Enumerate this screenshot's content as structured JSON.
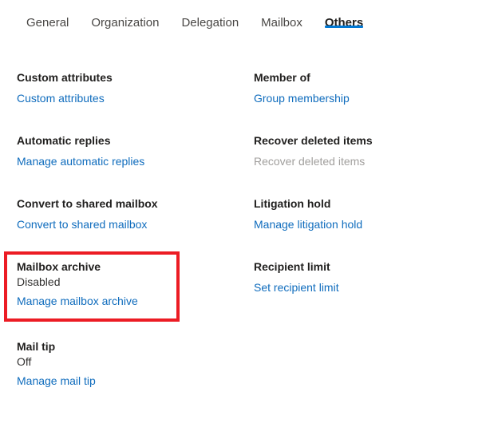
{
  "tabs": [
    {
      "label": "General",
      "active": false
    },
    {
      "label": "Organization",
      "active": false
    },
    {
      "label": "Delegation",
      "active": false
    },
    {
      "label": "Mailbox",
      "active": false
    },
    {
      "label": "Others",
      "active": true
    }
  ],
  "columns": {
    "left": [
      {
        "title": "Custom attributes",
        "status": null,
        "link": "Custom attributes",
        "link_disabled": false
      },
      {
        "title": "Automatic replies",
        "status": null,
        "link": "Manage automatic replies",
        "link_disabled": false
      },
      {
        "title": "Convert to shared mailbox",
        "status": null,
        "link": "Convert to shared mailbox",
        "link_disabled": false
      },
      {
        "title": "Mailbox archive",
        "status": "Disabled",
        "link": "Manage mailbox archive",
        "link_disabled": false
      },
      {
        "title": "Mail tip",
        "status": "Off",
        "link": "Manage mail tip",
        "link_disabled": false
      }
    ],
    "right": [
      {
        "title": "Member of",
        "status": null,
        "link": "Group membership",
        "link_disabled": false
      },
      {
        "title": "Recover deleted items",
        "status": null,
        "link": "Recover deleted items",
        "link_disabled": true
      },
      {
        "title": "Litigation hold",
        "status": null,
        "link": "Manage litigation hold",
        "link_disabled": false
      },
      {
        "title": "Recipient limit",
        "status": null,
        "link": "Set recipient limit",
        "link_disabled": false
      }
    ]
  },
  "annotation": {
    "color": "#ec1c24",
    "target": "Mailbox archive"
  },
  "colors": {
    "link": "#0f6cbd",
    "link_disabled": "#a19f9d",
    "tab_active_underline": "#0078d4",
    "heading": "#201f1e",
    "status": "#323130",
    "annotation_red": "#ec1c24"
  }
}
